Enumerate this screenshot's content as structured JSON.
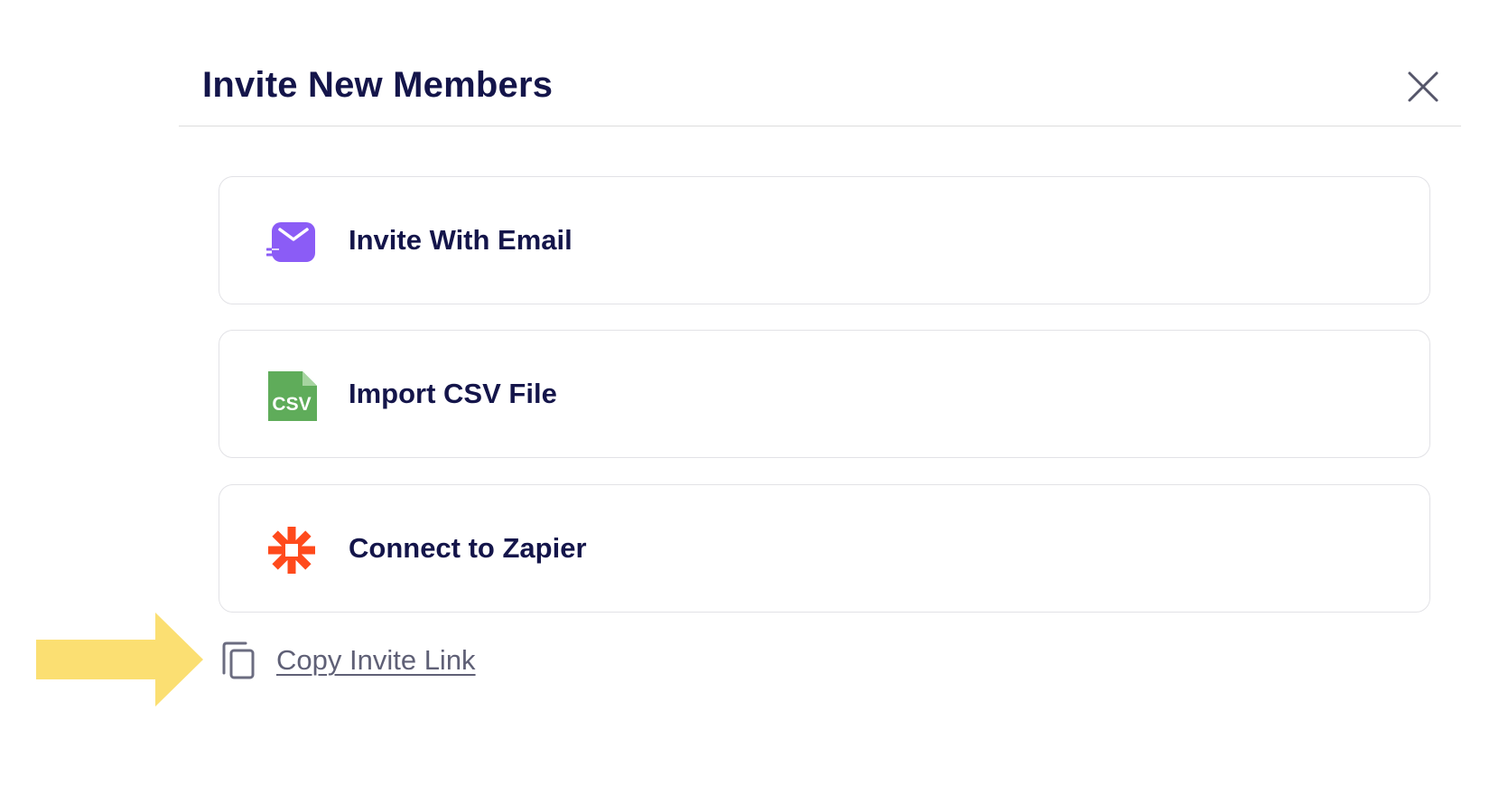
{
  "modal": {
    "title": "Invite New Members",
    "close_icon": "close-icon"
  },
  "options": [
    {
      "label": "Invite With Email",
      "icon": "email-icon",
      "icon_color": "#8b5cf6"
    },
    {
      "label": "Import CSV File",
      "icon": "csv-file-icon",
      "icon_color": "#5fac5a",
      "icon_text": "CSV"
    },
    {
      "label": "Connect to Zapier",
      "icon": "zapier-icon",
      "icon_color": "#ff4a1c"
    }
  ],
  "copy_link": {
    "label": "Copy Invite Link",
    "icon": "copy-icon"
  },
  "annotation": {
    "icon": "pointer-arrow",
    "color": "#fbdf72"
  },
  "colors": {
    "title": "#14154a",
    "link": "#5f6076",
    "card_border": "#e2e2e6"
  }
}
